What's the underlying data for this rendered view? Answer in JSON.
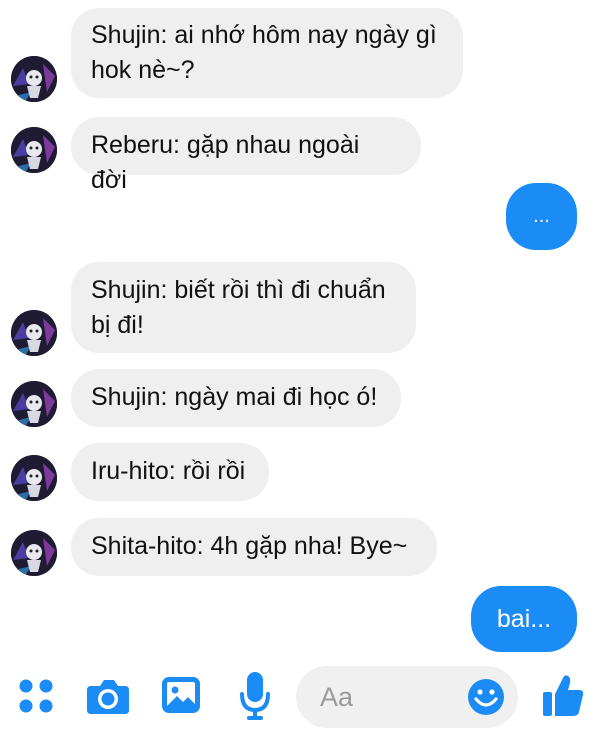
{
  "messages": [
    {
      "direction": "incoming",
      "text": "Shujin: ai nhớ hôm nay ngày gì hok nè~?",
      "lines": [
        "Shujin: ai nhớ hôm nay ngày gì",
        "hok nè~?"
      ]
    },
    {
      "direction": "incoming",
      "text": "Reberu: gặp nhau ngoài đời"
    },
    {
      "direction": "outgoing",
      "text": "..."
    },
    {
      "direction": "incoming",
      "text": "Shujin: biết rồi thì đi chuẩn bị đi!",
      "lines": [
        "Shujin: biết rồi thì đi chuẩn",
        "bị đi!"
      ]
    },
    {
      "direction": "incoming",
      "text": "Shujin: ngày mai đi học ó!"
    },
    {
      "direction": "incoming",
      "text": "Iru-hito: rồi rồi"
    },
    {
      "direction": "incoming",
      "text": "Shita-hito: 4h gặp nha! Bye~"
    },
    {
      "direction": "outgoing",
      "text": "bai..."
    }
  ],
  "composer": {
    "placeholder": "Aa",
    "icons": [
      "apps-icon",
      "camera-icon",
      "gallery-icon",
      "microphone-icon",
      "emoji-icon",
      "thumbs-up-icon"
    ]
  },
  "colors": {
    "accent": "#1b8bf5",
    "incoming_bubble": "#efefef",
    "outgoing_text": "#ffffff"
  }
}
